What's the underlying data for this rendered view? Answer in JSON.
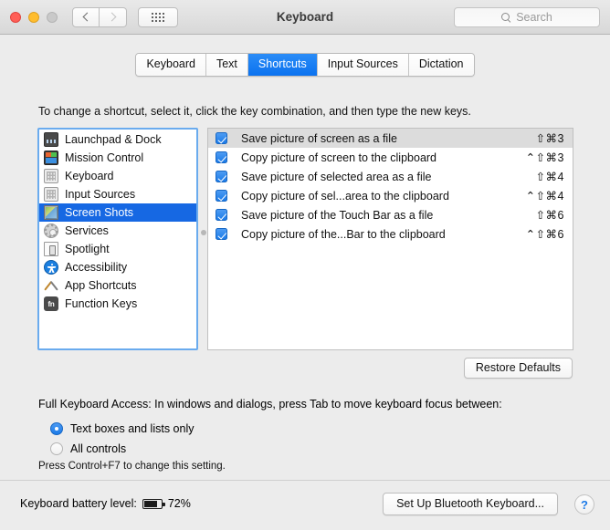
{
  "window": {
    "title": "Keyboard",
    "traffic_lights": [
      "close",
      "minimize",
      "zoom"
    ],
    "search_placeholder": "Search"
  },
  "tabs": [
    {
      "label": "Keyboard",
      "active": false
    },
    {
      "label": "Text",
      "active": false
    },
    {
      "label": "Shortcuts",
      "active": true
    },
    {
      "label": "Input Sources",
      "active": false
    },
    {
      "label": "Dictation",
      "active": false
    }
  ],
  "main": {
    "hint": "To change a shortcut, select it, click the key combination, and then type the new keys.",
    "restore_defaults_label": "Restore Defaults"
  },
  "sidebar": {
    "items": [
      {
        "label": "Launchpad & Dock",
        "icon": "dock-icon",
        "selected": false
      },
      {
        "label": "Mission Control",
        "icon": "mission-control-icon",
        "selected": false
      },
      {
        "label": "Keyboard",
        "icon": "keyboard-icon",
        "selected": false
      },
      {
        "label": "Input Sources",
        "icon": "input-sources-icon",
        "selected": false
      },
      {
        "label": "Screen Shots",
        "icon": "screenshot-icon",
        "selected": true
      },
      {
        "label": "Services",
        "icon": "gear-icon",
        "selected": false
      },
      {
        "label": "Spotlight",
        "icon": "spotlight-icon",
        "selected": false
      },
      {
        "label": "Accessibility",
        "icon": "accessibility-icon",
        "selected": false
      },
      {
        "label": "App Shortcuts",
        "icon": "app-shortcuts-icon",
        "selected": false
      },
      {
        "label": "Function Keys",
        "icon": "fn-key-icon",
        "selected": false
      }
    ]
  },
  "shortcuts": {
    "rows": [
      {
        "checked": true,
        "name": "Save picture of screen as a file",
        "combo": "⇧⌘3",
        "highlighted": true
      },
      {
        "checked": true,
        "name": "Copy picture of screen to the clipboard",
        "combo": "⌃⇧⌘3",
        "highlighted": false
      },
      {
        "checked": true,
        "name": "Save picture of selected area as a file",
        "combo": "⇧⌘4",
        "highlighted": false
      },
      {
        "checked": true,
        "name": "Copy picture of sel...area to the clipboard",
        "combo": "⌃⇧⌘4",
        "highlighted": false
      },
      {
        "checked": true,
        "name": "Save picture of the Touch Bar as a file",
        "combo": "⇧⌘6",
        "highlighted": false
      },
      {
        "checked": true,
        "name": "Copy picture of the...Bar to the clipboard",
        "combo": "⌃⇧⌘6",
        "highlighted": false
      }
    ]
  },
  "full_keyboard_access": {
    "label": "Full Keyboard Access: In windows and dialogs, press Tab to move keyboard focus between:",
    "options": [
      {
        "label": "Text boxes and lists only",
        "selected": true
      },
      {
        "label": "All controls",
        "selected": false
      }
    ],
    "note": "Press Control+F7 to change this setting."
  },
  "footer": {
    "battery_label": "Keyboard battery level:",
    "battery_percent": "72%",
    "bluetooth_button": "Set Up Bluetooth Keyboard...",
    "help_label": "?"
  },
  "colors": {
    "accent_blue": "#1668e3",
    "tab_active": "#0b72ef",
    "focus_ring": "#6aabee",
    "window_bg": "#ececec"
  }
}
